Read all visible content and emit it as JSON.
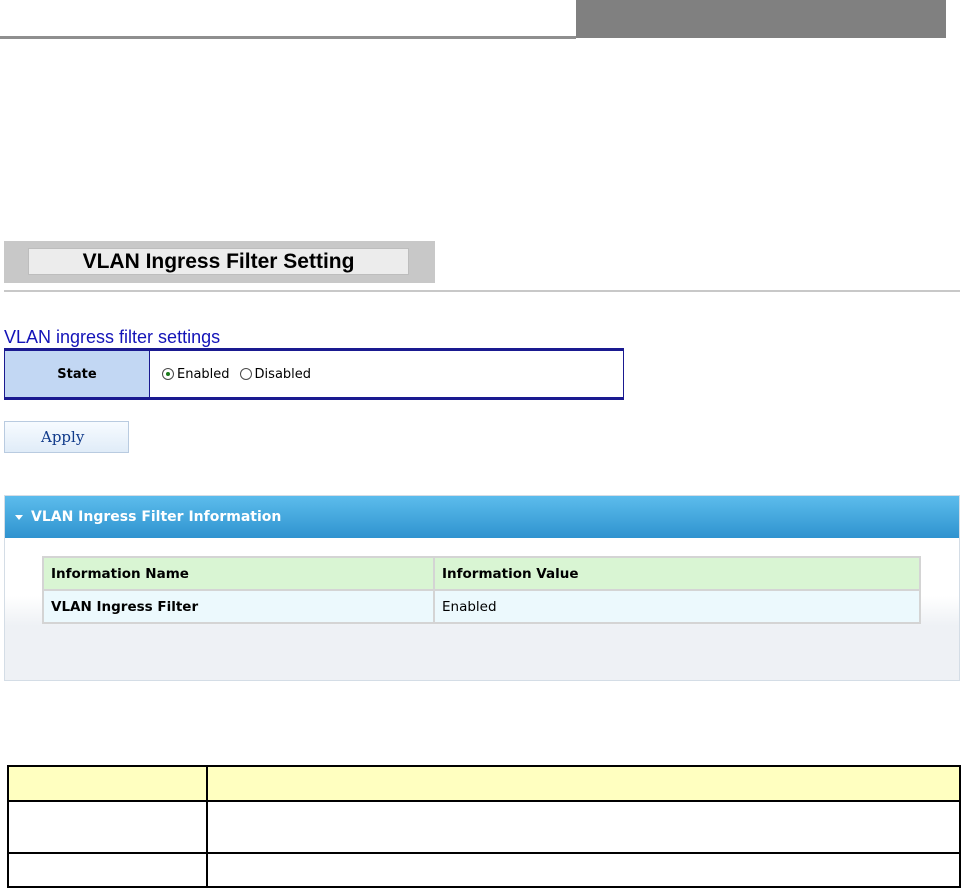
{
  "page": {
    "title": "VLAN Ingress Filter Setting"
  },
  "settings": {
    "heading": "VLAN ingress filter settings",
    "state_label": "State",
    "options": [
      {
        "label": "Enabled",
        "selected": true
      },
      {
        "label": "Disabled",
        "selected": false
      }
    ],
    "apply_label": "Apply"
  },
  "info": {
    "header": "VLAN Ingress Filter Information",
    "columns": [
      "Information Name",
      "Information Value"
    ],
    "rows": [
      {
        "name": "VLAN Ingress Filter",
        "value": "Enabled"
      }
    ]
  },
  "colors": {
    "heading": "#1313b8",
    "table_border": "#1a1a90",
    "panel_header": "#2f93cf",
    "table_header": "#d9f5d3",
    "desc_header": "#ffffc0"
  }
}
